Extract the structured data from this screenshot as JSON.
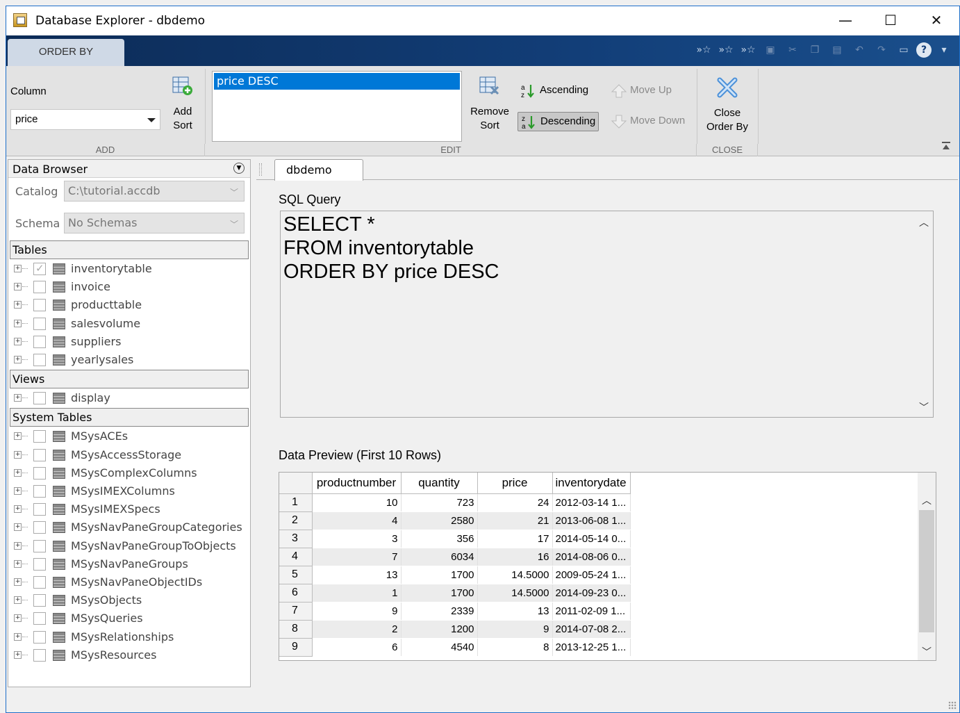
{
  "window": {
    "title": "Database Explorer - dbdemo",
    "controls": {
      "minimize": "—",
      "maximize": "☐",
      "close": "✕"
    }
  },
  "toolstrip": {
    "active_tab": "ORDER BY",
    "quick_access": [
      "run-selected-icon",
      "run-icon",
      "run-all-icon",
      "save-icon",
      "cut-icon",
      "copy-icon",
      "paste-icon",
      "undo-icon",
      "redo-icon",
      "layout-icon",
      "help-icon",
      "expand-icon"
    ]
  },
  "ribbon": {
    "add": {
      "column_label": "Column",
      "column_value": "price",
      "add_sort_line1": "Add",
      "add_sort_line2": "Sort",
      "section": "ADD"
    },
    "edit": {
      "sort_items": [
        "price DESC"
      ],
      "remove_sort_line1": "Remove",
      "remove_sort_line2": "Sort",
      "ascending": "Ascending",
      "descending": "Descending",
      "move_up": "Move Up",
      "move_down": "Move Down",
      "section": "EDIT"
    },
    "close": {
      "close_line1": "Close",
      "close_line2": "Order By",
      "section": "CLOSE"
    }
  },
  "data_browser": {
    "title": "Data Browser",
    "catalog_label": "Catalog",
    "catalog_value": "C:\\tutorial.accdb",
    "schema_label": "Schema",
    "schema_value": "No Schemas",
    "groups": [
      {
        "name": "Tables",
        "items": [
          {
            "name": "inventorytable",
            "checked": true
          },
          {
            "name": "invoice",
            "checked": false
          },
          {
            "name": "producttable",
            "checked": false
          },
          {
            "name": "salesvolume",
            "checked": false
          },
          {
            "name": "suppliers",
            "checked": false
          },
          {
            "name": "yearlysales",
            "checked": false
          }
        ]
      },
      {
        "name": "Views",
        "items": [
          {
            "name": "display",
            "checked": false
          }
        ]
      },
      {
        "name": "System Tables",
        "items": [
          {
            "name": "MSysACEs",
            "checked": false
          },
          {
            "name": "MSysAccessStorage",
            "checked": false
          },
          {
            "name": "MSysComplexColumns",
            "checked": false
          },
          {
            "name": "MSysIMEXColumns",
            "checked": false
          },
          {
            "name": "MSysIMEXSpecs",
            "checked": false
          },
          {
            "name": "MSysNavPaneGroupCategories",
            "checked": false
          },
          {
            "name": "MSysNavPaneGroupToObjects",
            "checked": false
          },
          {
            "name": "MSysNavPaneGroups",
            "checked": false
          },
          {
            "name": "MSysNavPaneObjectIDs",
            "checked": false
          },
          {
            "name": "MSysObjects",
            "checked": false
          },
          {
            "name": "MSysQueries",
            "checked": false
          },
          {
            "name": "MSysRelationships",
            "checked": false
          },
          {
            "name": "MSysResources",
            "checked": false
          }
        ]
      }
    ]
  },
  "document": {
    "tab": "dbdemo",
    "sql_label": "SQL Query",
    "sql_text": "SELECT *\nFROM inventorytable\nORDER BY price DESC",
    "preview_label": "Data Preview (First 10 Rows)",
    "columns": [
      "productnumber",
      "quantity",
      "price",
      "inventorydate"
    ],
    "rows": [
      [
        "1",
        "10",
        "723",
        "24",
        "2012-03-14 1..."
      ],
      [
        "2",
        "4",
        "2580",
        "21",
        "2013-06-08 1..."
      ],
      [
        "3",
        "3",
        "356",
        "17",
        "2014-05-14 0..."
      ],
      [
        "4",
        "7",
        "6034",
        "16",
        "2014-08-06 0..."
      ],
      [
        "5",
        "13",
        "1700",
        "14.5000",
        "2009-05-24 1..."
      ],
      [
        "6",
        "1",
        "1700",
        "14.5000",
        "2014-09-23 0..."
      ],
      [
        "7",
        "9",
        "2339",
        "13",
        "2011-02-09 1..."
      ],
      [
        "8",
        "2",
        "1200",
        "9",
        "2014-07-08 2..."
      ],
      [
        "9",
        "6",
        "4540",
        "8",
        "2013-12-25 1..."
      ]
    ]
  }
}
